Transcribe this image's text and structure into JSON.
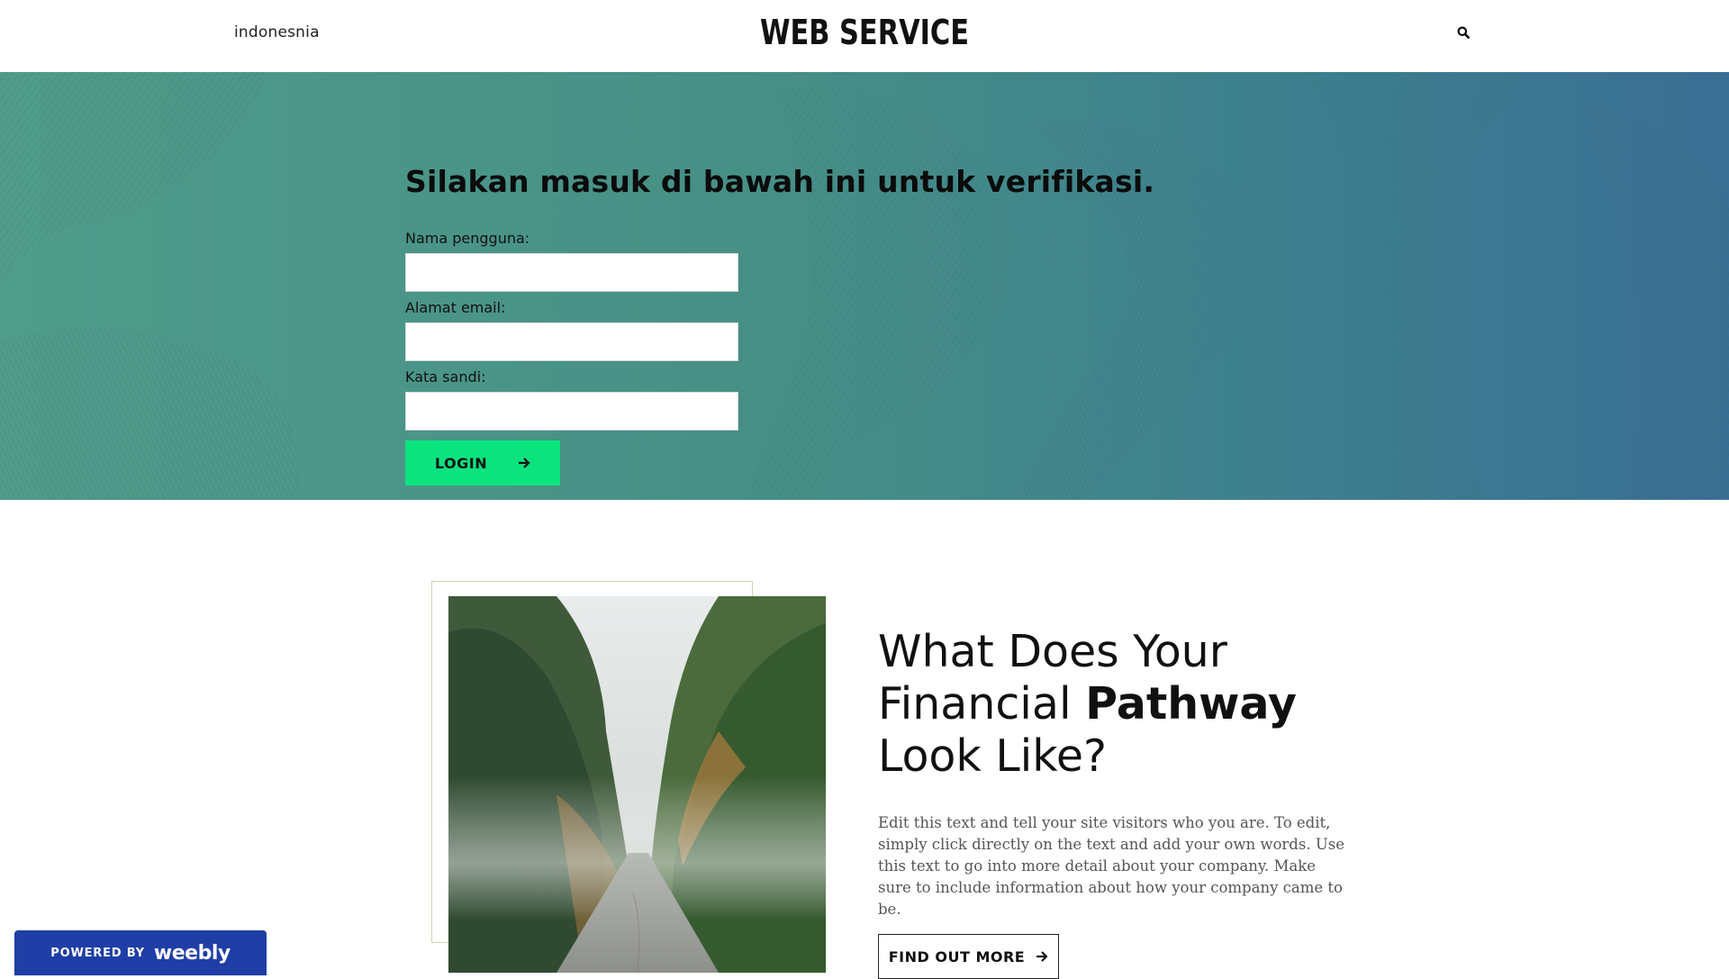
{
  "header": {
    "brand_left": "indonesnia",
    "site_title": "WEB SERVICE",
    "search_icon": "search-icon"
  },
  "hero": {
    "title": "Silakan masuk di bawah ini untuk verifikasi.",
    "fields": [
      {
        "label": "Nama pengguna:",
        "value": "",
        "placeholder": ""
      },
      {
        "label": "Alamat email:",
        "value": "",
        "placeholder": ""
      },
      {
        "label": "Kata sandi:",
        "value": "",
        "placeholder": ""
      }
    ],
    "login_label": "LOGIN",
    "login_icon": "arrow-right-icon",
    "background_colors": [
      "#4f9c8a",
      "#3a6f94"
    ],
    "button_color": "#0be37f"
  },
  "feature": {
    "heading_pre": "What Does Your Financial ",
    "heading_bold": "Pathway",
    "heading_post": " Look Like?",
    "text": "Edit this text and tell your site visitors who you are. To edit, simply click directly on the text and add your own words. Use this text to go into more detail about your company. Make sure to include information about how your company came to be.",
    "button_label": "FIND OUT MORE",
    "button_icon": "arrow-right-icon",
    "image": "forest-road-photo"
  },
  "badge": {
    "powered_by": "POWERED BY",
    "logo_text": "weebly",
    "color": "#1f3ea6"
  }
}
